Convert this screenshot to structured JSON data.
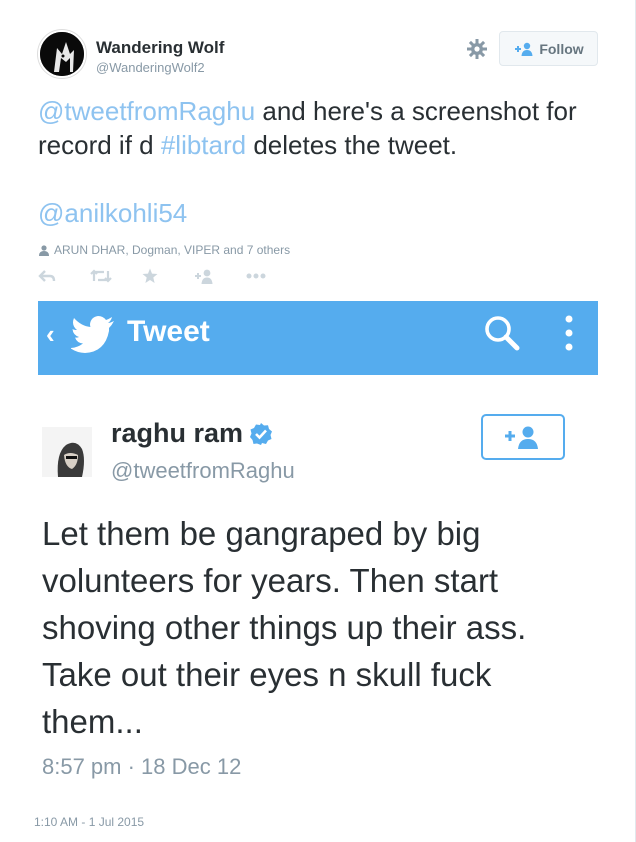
{
  "author": {
    "display_name": "Wandering Wolf",
    "handle": "@WanderingWolf2",
    "follow_label": "Follow"
  },
  "tweet": {
    "mention_1": "@tweetfromRaghu",
    "text_1": " and here's a screenshot for record if d ",
    "hashtag": "#libtard",
    "text_2": " deletes the tweet.",
    "reply_mention": "@anilkohli54",
    "retweeters": "ARUN DHAR, Dogman, VIPER and 7 others",
    "timestamp": "1:10 AM - 1 Jul 2015"
  },
  "actions": [
    {
      "name": "reply-icon"
    },
    {
      "name": "retweet-icon"
    },
    {
      "name": "favorite-icon"
    },
    {
      "name": "follow-user-icon"
    },
    {
      "name": "more-icon"
    }
  ],
  "embedded": {
    "bar_title": "Tweet",
    "back_glyph": "‹",
    "user_name": "raghu ram",
    "user_handle": "@tweetfromRaghu",
    "text": "Let them be gangraped by big volunteers for years. Then start shoving other things up their ass. Take out their eyes n skull fuck them...",
    "time": "8:57 pm · 18 Dec 12"
  },
  "colors": {
    "twitter_blue": "#55acee",
    "link": "#8ec3f0",
    "text": "#292f33",
    "muted": "#8899a6"
  }
}
